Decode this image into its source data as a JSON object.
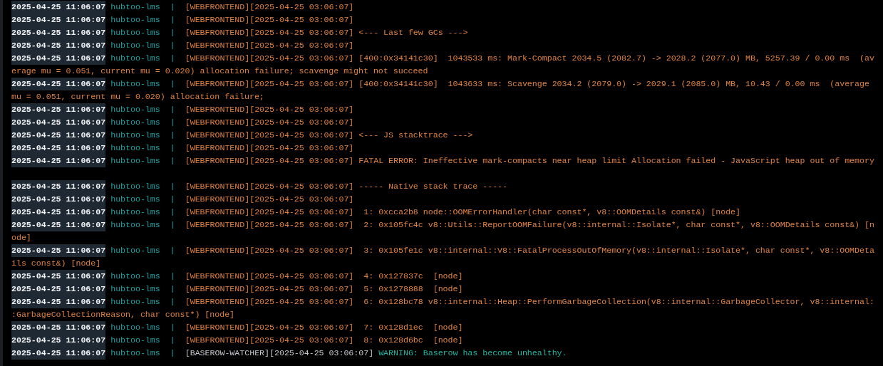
{
  "log_lines": [
    {
      "time": "2025-04-25 11:06:07",
      "service": "hubtoo-lms",
      "separator": "|",
      "source": "[WEBFRONTEND][2025-04-25 03:06:07]",
      "kind": "webfrontend"
    },
    {
      "time": "2025-04-25 11:06:07",
      "service": "hubtoo-lms",
      "separator": "|",
      "source": "[WEBFRONTEND][2025-04-25 03:06:07]",
      "kind": "webfrontend"
    },
    {
      "time": "2025-04-25 11:06:07",
      "service": "hubtoo-lms",
      "separator": "|",
      "source": "[WEBFRONTEND][2025-04-25 03:06:07]",
      "message": "<--- Last few GCs --->",
      "kind": "webfrontend"
    },
    {
      "time": "2025-04-25 11:06:07",
      "service": "hubtoo-lms",
      "separator": "|",
      "source": "[WEBFRONTEND][2025-04-25 03:06:07]",
      "kind": "webfrontend"
    },
    {
      "time": "2025-04-25 11:06:07",
      "service": "hubtoo-lms",
      "separator": "|",
      "source": "[WEBFRONTEND][2025-04-25 03:06:07]",
      "message": "[400:0x34141c30]  1043533 ms: Mark-Compact 2034.5 (2082.7) -> 2028.2 (2077.0) MB, 5257.39 / 0.00 ms  (av",
      "continuation": "erage mu = 0.051, current mu = 0.020) allocation failure; scavenge might not succeed",
      "kind": "webfrontend"
    },
    {
      "time": "2025-04-25 11:06:07",
      "service": "hubtoo-lms",
      "separator": "|",
      "source": "[WEBFRONTEND][2025-04-25 03:06:07]",
      "message": "[400:0x34141c30]  1043633 ms: Scavenge 2034.2 (2079.0) -> 2029.1 (2085.0) MB, 10.43 / 0.00 ms  (average",
      "continuation": "mu = 0.051, current mu = 0.020) allocation failure;",
      "kind": "webfrontend"
    },
    {
      "time": "2025-04-25 11:06:07",
      "service": "hubtoo-lms",
      "separator": "|",
      "source": "[WEBFRONTEND][2025-04-25 03:06:07]",
      "kind": "webfrontend"
    },
    {
      "time": "2025-04-25 11:06:07",
      "service": "hubtoo-lms",
      "separator": "|",
      "source": "[WEBFRONTEND][2025-04-25 03:06:07]",
      "kind": "webfrontend"
    },
    {
      "time": "2025-04-25 11:06:07",
      "service": "hubtoo-lms",
      "separator": "|",
      "source": "[WEBFRONTEND][2025-04-25 03:06:07]",
      "message": "<--- JS stacktrace --->",
      "kind": "webfrontend"
    },
    {
      "time": "2025-04-25 11:06:07",
      "service": "hubtoo-lms",
      "separator": "|",
      "source": "[WEBFRONTEND][2025-04-25 03:06:07]",
      "kind": "webfrontend"
    },
    {
      "time": "2025-04-25 11:06:07",
      "service": "hubtoo-lms",
      "separator": "|",
      "source": "[WEBFRONTEND][2025-04-25 03:06:07]",
      "message": "FATAL ERROR: Ineffective mark-compacts near heap limit Allocation failed - JavaScript heap out of memory",
      "kind": "webfrontend",
      "blank_after": true
    },
    {
      "time": "2025-04-25 11:06:07",
      "service": "hubtoo-lms",
      "separator": "|",
      "source": "[WEBFRONTEND][2025-04-25 03:06:07]",
      "message": "----- Native stack trace -----",
      "kind": "webfrontend"
    },
    {
      "time": "2025-04-25 11:06:07",
      "service": "hubtoo-lms",
      "separator": "|",
      "source": "[WEBFRONTEND][2025-04-25 03:06:07]",
      "kind": "webfrontend"
    },
    {
      "time": "2025-04-25 11:06:07",
      "service": "hubtoo-lms",
      "separator": "|",
      "source": "[WEBFRONTEND][2025-04-25 03:06:07]",
      "message": " 1: 0xcca2b8 node::OOMErrorHandler(char const*, v8::OOMDetails const&) [node]",
      "kind": "webfrontend"
    },
    {
      "time": "2025-04-25 11:06:07",
      "service": "hubtoo-lms",
      "separator": "|",
      "source": "[WEBFRONTEND][2025-04-25 03:06:07]",
      "message": " 2: 0x105fc4c v8::Utils::ReportOOMFailure(v8::internal::Isolate*, char const*, v8::OOMDetails const&) [n",
      "continuation": "ode]",
      "kind": "webfrontend"
    },
    {
      "time": "2025-04-25 11:06:07",
      "service": "hubtoo-lms",
      "separator": "|",
      "source": "[WEBFRONTEND][2025-04-25 03:06:07]",
      "message": " 3: 0x105fe1c v8::internal::V8::FatalProcessOutOfMemory(v8::internal::Isolate*, char const*, v8::OOMDeta",
      "continuation": "ils const&) [node]",
      "kind": "webfrontend"
    },
    {
      "time": "2025-04-25 11:06:07",
      "service": "hubtoo-lms",
      "separator": "|",
      "source": "[WEBFRONTEND][2025-04-25 03:06:07]",
      "message": " 4: 0x127837c  [node]",
      "kind": "webfrontend"
    },
    {
      "time": "2025-04-25 11:06:07",
      "service": "hubtoo-lms",
      "separator": "|",
      "source": "[WEBFRONTEND][2025-04-25 03:06:07]",
      "message": " 5: 0x1278888  [node]",
      "kind": "webfrontend"
    },
    {
      "time": "2025-04-25 11:06:07",
      "service": "hubtoo-lms",
      "separator": "|",
      "source": "[WEBFRONTEND][2025-04-25 03:06:07]",
      "message": " 6: 0x128bc78 v8::internal::Heap::PerformGarbageCollection(v8::internal::GarbageCollector, v8::internal:",
      "continuation": ":GarbageCollectionReason, char const*) [node]",
      "kind": "webfrontend"
    },
    {
      "time": "2025-04-25 11:06:07",
      "service": "hubtoo-lms",
      "separator": "|",
      "source": "[WEBFRONTEND][2025-04-25 03:06:07]",
      "message": " 7: 0x128d1ec  [node]",
      "kind": "webfrontend"
    },
    {
      "time": "2025-04-25 11:06:07",
      "service": "hubtoo-lms",
      "separator": "|",
      "source": "[WEBFRONTEND][2025-04-25 03:06:07]",
      "message": " 8: 0x128d6bc  [node]",
      "kind": "webfrontend"
    },
    {
      "time": "2025-04-25 11:06:07",
      "service": "hubtoo-lms",
      "separator": "|",
      "source": "[BASEROW-WATCHER][2025-04-25 03:06:07]",
      "message": "WARNING: Baserow has become unhealthy.",
      "kind": "watcher"
    }
  ]
}
